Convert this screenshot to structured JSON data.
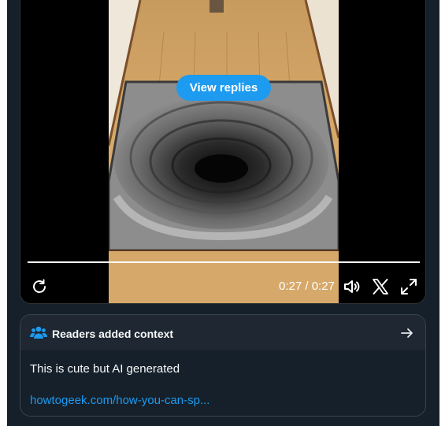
{
  "video": {
    "view_replies_label": "View replies",
    "time": "0:27 / 0:27",
    "progress_fraction": 1.0,
    "controls": {
      "replay_icon": "replay-icon",
      "volume_icon": "volume-icon",
      "x_icon": "x-logo-icon",
      "fullscreen_icon": "fullscreen-icon"
    }
  },
  "context": {
    "title": "Readers added context",
    "body": "This is cute but AI generated",
    "link": "howtogeek.com/how-you-can-sp..."
  },
  "colors": {
    "accent": "#1d9bf0",
    "background": "#15202b"
  }
}
